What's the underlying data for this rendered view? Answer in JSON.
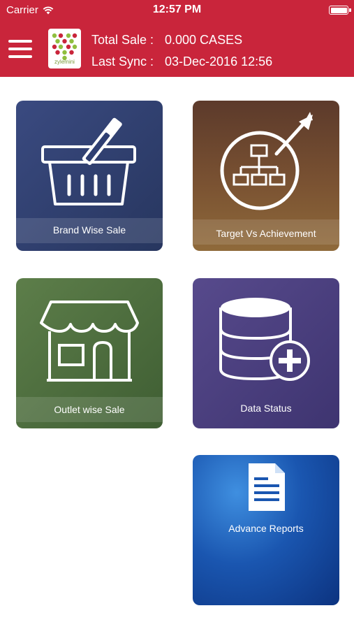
{
  "status_bar": {
    "carrier": "Carrier",
    "time": "12:57 PM"
  },
  "header": {
    "logo_text": "zylemini",
    "total_sale_label": "Total Sale :",
    "total_sale_value": "0.000 CASES",
    "last_sync_label": "Last Sync :",
    "last_sync_value": "03-Dec-2016 12:56"
  },
  "tiles": [
    {
      "label": "Brand Wise Sale",
      "icon": "basket-icon",
      "color": "#2f3f72"
    },
    {
      "label": "Target Vs Achievement",
      "icon": "hierarchy-target-icon",
      "color": "#6b4630"
    },
    {
      "label": "Outlet wise Sale",
      "icon": "shop-icon",
      "color": "#4d6d3a"
    },
    {
      "label": "Data Status",
      "icon": "database-add-icon",
      "color": "#4a3f7c"
    },
    {
      "label": "Advance Reports",
      "icon": "document-icon",
      "color": "#1a56b0"
    }
  ],
  "colors": {
    "header": "#c9253b"
  }
}
